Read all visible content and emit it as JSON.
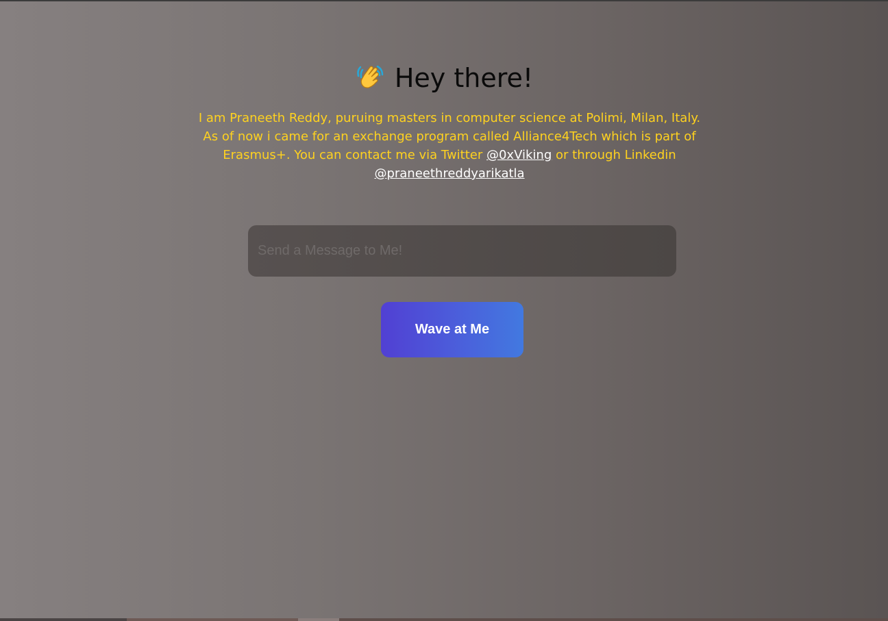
{
  "header": {
    "icon": "waving-hand-icon",
    "title": "Hey there!"
  },
  "bio": {
    "text_before_twitter": "I am Praneeth Reddy, puruing masters in computer science at Polimi, Milan, Italy. As of now i came for an exchange program called Alliance4Tech which is part of Erasmus+. You can contact me via Twitter ",
    "twitter_link": "@0xViking",
    "text_between": " or through Linkedin ",
    "linkedin_link": "@praneethreddyarikatla"
  },
  "message": {
    "placeholder": "Send a Message to Me!",
    "value": ""
  },
  "wave_button": {
    "label": "Wave at Me"
  },
  "colors": {
    "bio_text": "#ffd21f",
    "link": "#ffffff",
    "button_gradient_start": "#5140d3",
    "button_gradient_end": "#4279e0"
  }
}
